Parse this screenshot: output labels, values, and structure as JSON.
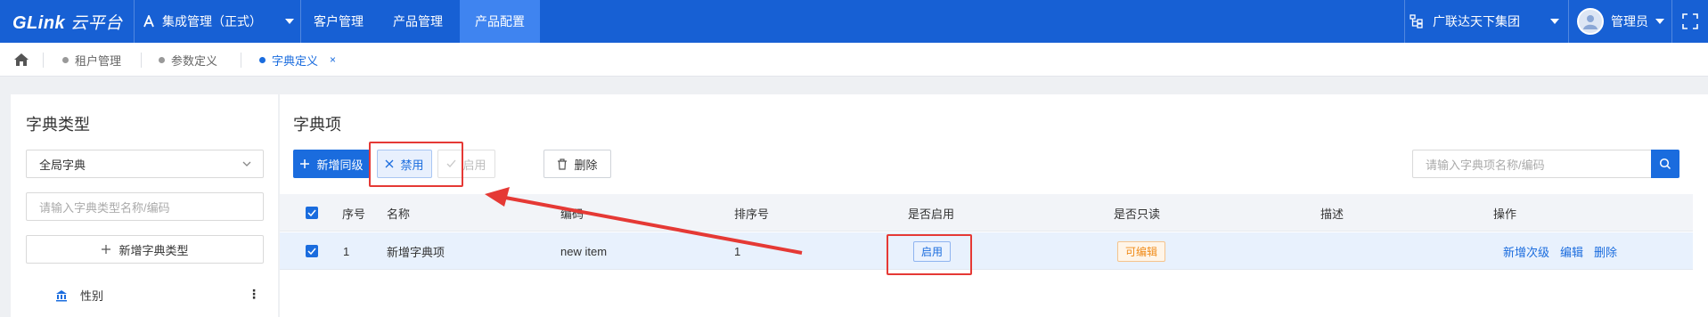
{
  "topbar": {
    "logo_text": "GLink",
    "logo_cloud": "云平台",
    "module_label": "集成管理（正式）",
    "nav": [
      {
        "label": "客户管理"
      },
      {
        "label": "产品管理"
      },
      {
        "label": "产品配置",
        "active": true
      }
    ],
    "org_label": "广联达天下集团",
    "user_label": "管理员"
  },
  "tabs": [
    {
      "label": "租户管理"
    },
    {
      "label": "参数定义"
    },
    {
      "label": "字典定义",
      "active": true,
      "close": "×"
    }
  ],
  "left": {
    "title": "字典类型",
    "select_value": "全局字典",
    "search_placeholder": "请输入字典类型名称/编码",
    "add_button": "新增字典类型",
    "tree_items": [
      {
        "label": "性别"
      }
    ]
  },
  "right": {
    "title": "字典项",
    "buttons": {
      "add_sibling": "新增同级",
      "disable": "禁用",
      "enable": "启用",
      "delete": "删除"
    },
    "search_placeholder": "请输入字典项名称/编码",
    "columns": [
      "序号",
      "名称",
      "编码",
      "排序号",
      "是否启用",
      "是否只读",
      "描述",
      "操作"
    ],
    "rows": [
      {
        "index": "1",
        "name": "新增字典项",
        "code": "new item",
        "sort": "1",
        "enabled": "启用",
        "readonly": "可编辑",
        "description": "",
        "actions": [
          "新增次级",
          "编辑",
          "删除"
        ]
      }
    ]
  },
  "colors": {
    "topbar": "#1760d4",
    "nav_active": "#3f84f0",
    "primary": "#1a6cde",
    "annotation_red": "#e53935",
    "tag_orange": "#f08c1a"
  }
}
